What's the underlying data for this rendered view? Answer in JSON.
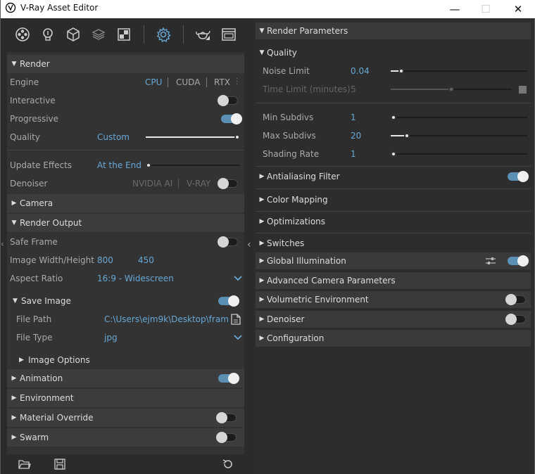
{
  "window": {
    "title": "V-Ray Asset Editor",
    "minimize": "—",
    "maximize": "☐",
    "close": "✕"
  },
  "toolbar": {
    "icons": [
      "materials-icon",
      "lights-icon",
      "geometry-icon",
      "layers-icon",
      "textures-icon",
      "settings-icon",
      "render-teapot-icon",
      "frame-buffer-icon"
    ]
  },
  "left": {
    "render": {
      "header": "Render",
      "engine_label": "Engine",
      "engines": [
        "CPU",
        "CUDA",
        "RTX"
      ],
      "interactive_label": "Interactive",
      "interactive": false,
      "progressive_label": "Progressive",
      "progressive": true,
      "quality_label": "Quality",
      "quality_value": "Custom",
      "quality_level": 1.0,
      "update_effects_label": "Update Effects",
      "update_effects_value": "At the End",
      "update_effects_level": 0.0,
      "denoiser_label": "Denoiser",
      "denoiser_options": [
        "NVIDIA AI",
        "V-RAY"
      ],
      "denoiser": false
    },
    "camera": {
      "header": "Camera"
    },
    "render_output": {
      "header": "Render Output",
      "safe_frame_label": "Safe Frame",
      "safe_frame": false,
      "image_size_label": "Image Width/Height",
      "width": "800",
      "height": "450",
      "aspect_label": "Aspect Ratio",
      "aspect_value": "16:9 - Widescreen",
      "save_image_header": "Save Image",
      "save_image": true,
      "file_path_label": "File Path",
      "file_path_value": "C:\\Users\\ejm9k\\Desktop\\frame...",
      "file_type_label": "File Type",
      "file_type_value": "jpg",
      "image_options_header": "Image Options"
    },
    "animation": {
      "header": "Animation",
      "on": true
    },
    "environment": {
      "header": "Environment"
    },
    "material_override": {
      "header": "Material Override",
      "on": false
    },
    "swarm": {
      "header": "Swarm",
      "on": false
    }
  },
  "right": {
    "render_parameters": {
      "header": "Render Parameters"
    },
    "quality": {
      "header": "Quality",
      "noise_limit_label": "Noise Limit",
      "noise_limit_value": "0.04",
      "noise_limit_level": 0.06,
      "time_limit_label": "Time Limit (minutes)",
      "time_limit_value": "5",
      "time_limit_level": 0.5,
      "min_subdivs_label": "Min Subdivs",
      "min_subdivs_value": "1",
      "min_subdivs_level": 0.0,
      "max_subdivs_label": "Max Subdivs",
      "max_subdivs_value": "20",
      "max_subdivs_level": 0.1,
      "shading_rate_label": "Shading Rate",
      "shading_rate_value": "1",
      "shading_rate_level": 0.0
    },
    "sections": [
      {
        "label": "Antialiasing Filter",
        "toggle": true
      },
      {
        "label": "Color Mapping"
      },
      {
        "label": "Optimizations"
      },
      {
        "label": "Switches"
      },
      {
        "label": "Global Illumination",
        "toggle": true
      },
      {
        "label": "Advanced Camera Parameters"
      },
      {
        "label": "Volumetric Environment",
        "toggle": false
      },
      {
        "label": "Denoiser",
        "toggle": false
      },
      {
        "label": "Configuration"
      }
    ]
  },
  "colors": {
    "accent": "#67a8d6",
    "toggle_on": "#5b8fb4",
    "panel": "#333333",
    "header": "#3c3c3c"
  }
}
